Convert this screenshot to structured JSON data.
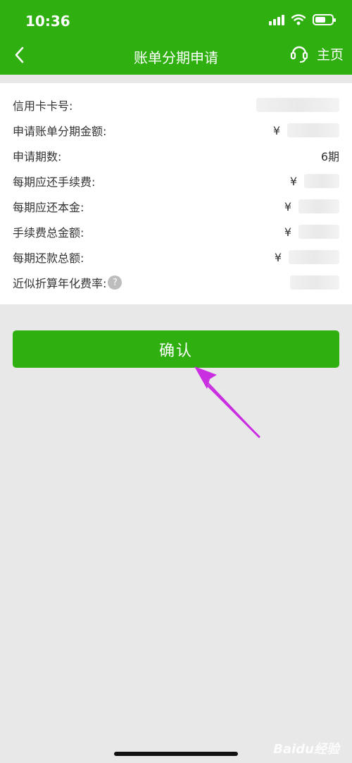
{
  "status": {
    "time": "10:36"
  },
  "nav": {
    "title": "账单分期申请",
    "home_label": "主页"
  },
  "colors": {
    "primary": "#2fb010",
    "background": "#e8e8e8",
    "annotation_arrow": "#c92ee0"
  },
  "rows": [
    {
      "label": "信用卡卡号:",
      "prefix": "",
      "value": ""
    },
    {
      "label": "申请账单分期金额:",
      "prefix": "¥",
      "value": ""
    },
    {
      "label": "申请期数:",
      "prefix": "",
      "value": "6期"
    },
    {
      "label": "每期应还手续费:",
      "prefix": "¥",
      "value": ""
    },
    {
      "label": "每期应还本金:",
      "prefix": "¥",
      "value": ""
    },
    {
      "label": "手续费总金额:",
      "prefix": "¥",
      "value": ""
    },
    {
      "label": "每期还款总额:",
      "prefix": "¥",
      "value": ""
    },
    {
      "label": "近似折算年化费率:",
      "prefix": "",
      "value": ""
    }
  ],
  "help_glyph": "?",
  "confirm_label": "确认",
  "watermark": "Baidu经验"
}
